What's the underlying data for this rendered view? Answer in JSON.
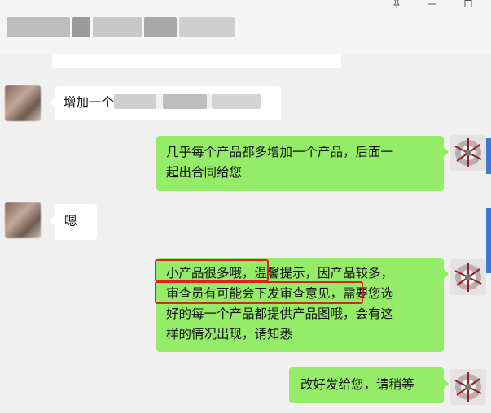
{
  "window": {
    "pin_icon": "pin-icon",
    "minimize_icon": "minimize-icon",
    "maximize_icon": "maximize-icon"
  },
  "messages": [
    {
      "side": "in",
      "text": "增加一个"
    },
    {
      "side": "out",
      "line1": "几乎每个产品都多增加一个产品，后面一",
      "line2": "起出合同给您"
    },
    {
      "side": "in",
      "text": "嗯"
    },
    {
      "side": "out",
      "highlight1": "小产品很多哦，",
      "rest1": "温馨提示，因产品较多，",
      "highlight2": "审查员有可能会下发审查意见",
      "rest2": "，需要您选",
      "line3": "好的每一个产品都提供产品图哦，会有这",
      "line4": "样的情况出现，请知悉"
    },
    {
      "side": "out",
      "text": "改好发给您，请稍等"
    }
  ],
  "colors": {
    "outgoing_bubble": "#95ec69",
    "incoming_bubble": "#ffffff",
    "highlight_box": "#e02020",
    "background": "#f0f0f0"
  }
}
